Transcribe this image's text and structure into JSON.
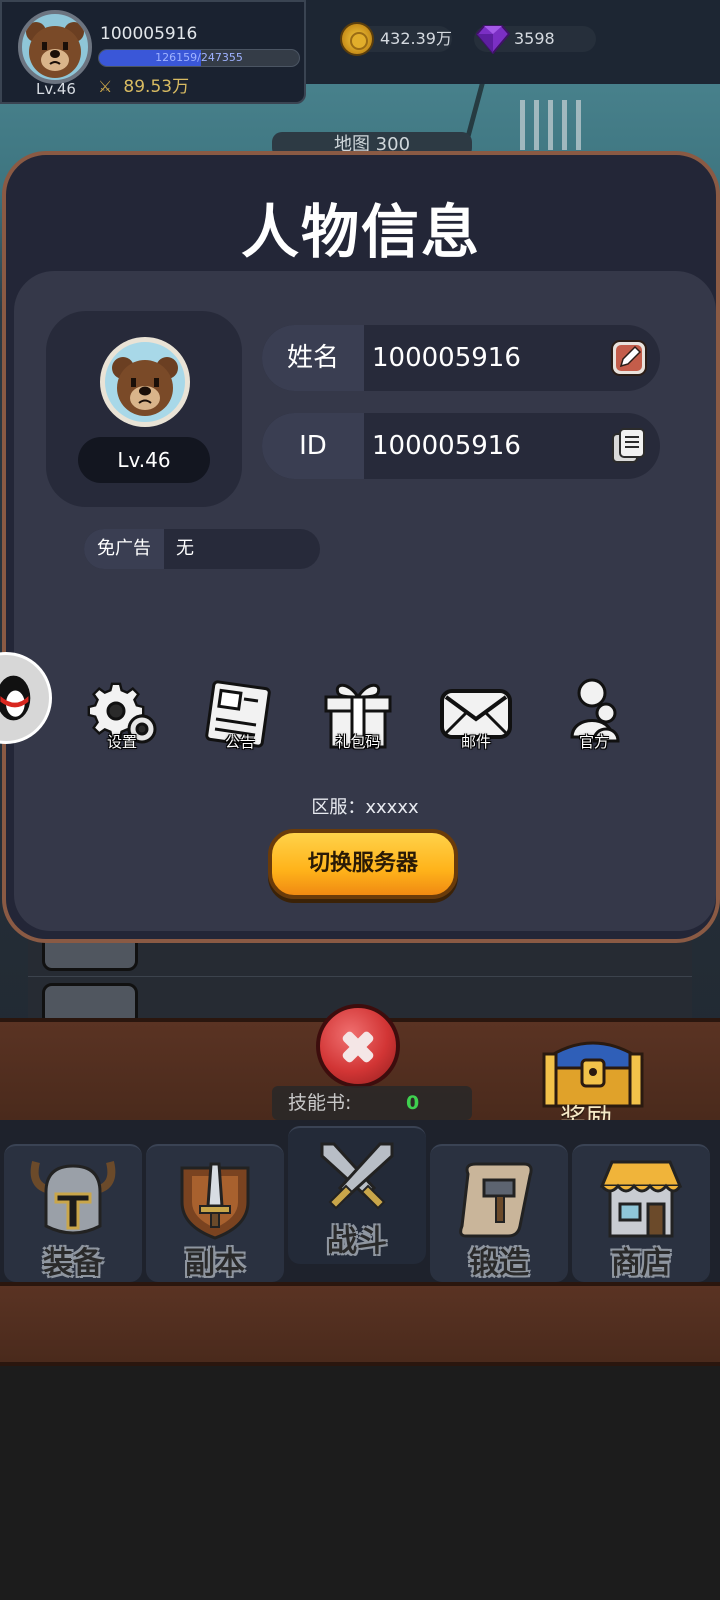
{
  "hud": {
    "player_name": "100005916",
    "level": "Lv.46",
    "xp_text": "126159/247355",
    "xp_fraction": 0.51,
    "power": "89.53万",
    "gold": "432.39万",
    "gems": "3598"
  },
  "background": {
    "map_label": "地图 300"
  },
  "modal": {
    "title": "人物信息",
    "avatar_level": "Lv.46",
    "name_key": "姓名",
    "name_value": "100005916",
    "id_key": "ID",
    "id_value": "100005916",
    "ad_key": "免广告",
    "ad_value": "无",
    "actions": [
      {
        "label": "设置",
        "icon": "gear-icon"
      },
      {
        "label": "公告",
        "icon": "notice-icon"
      },
      {
        "label": "礼包码",
        "icon": "gift-icon"
      },
      {
        "label": "邮件",
        "icon": "mail-icon"
      },
      {
        "label": "官方",
        "icon": "user-icon"
      }
    ],
    "server_text": "区服：xxxxx",
    "switch_server_label": "切换服务器"
  },
  "bottom": {
    "skill_book_label": "技能书:",
    "skill_book_count": "0",
    "reward_label": "奖励"
  },
  "nav": {
    "tabs": [
      {
        "label": "装备",
        "icon": "helmet-icon"
      },
      {
        "label": "副本",
        "icon": "sword-shield-icon"
      },
      {
        "label": "战斗",
        "icon": "crossed-swords-icon"
      },
      {
        "label": "锻造",
        "icon": "scroll-hammer-icon"
      },
      {
        "label": "商店",
        "icon": "shop-icon"
      }
    ]
  },
  "colors": {
    "modal_border": "#8a5a44",
    "switch_button": "#ffb31a",
    "skill_count": "#3fd04f",
    "xp_bar": "#3a57d8"
  }
}
